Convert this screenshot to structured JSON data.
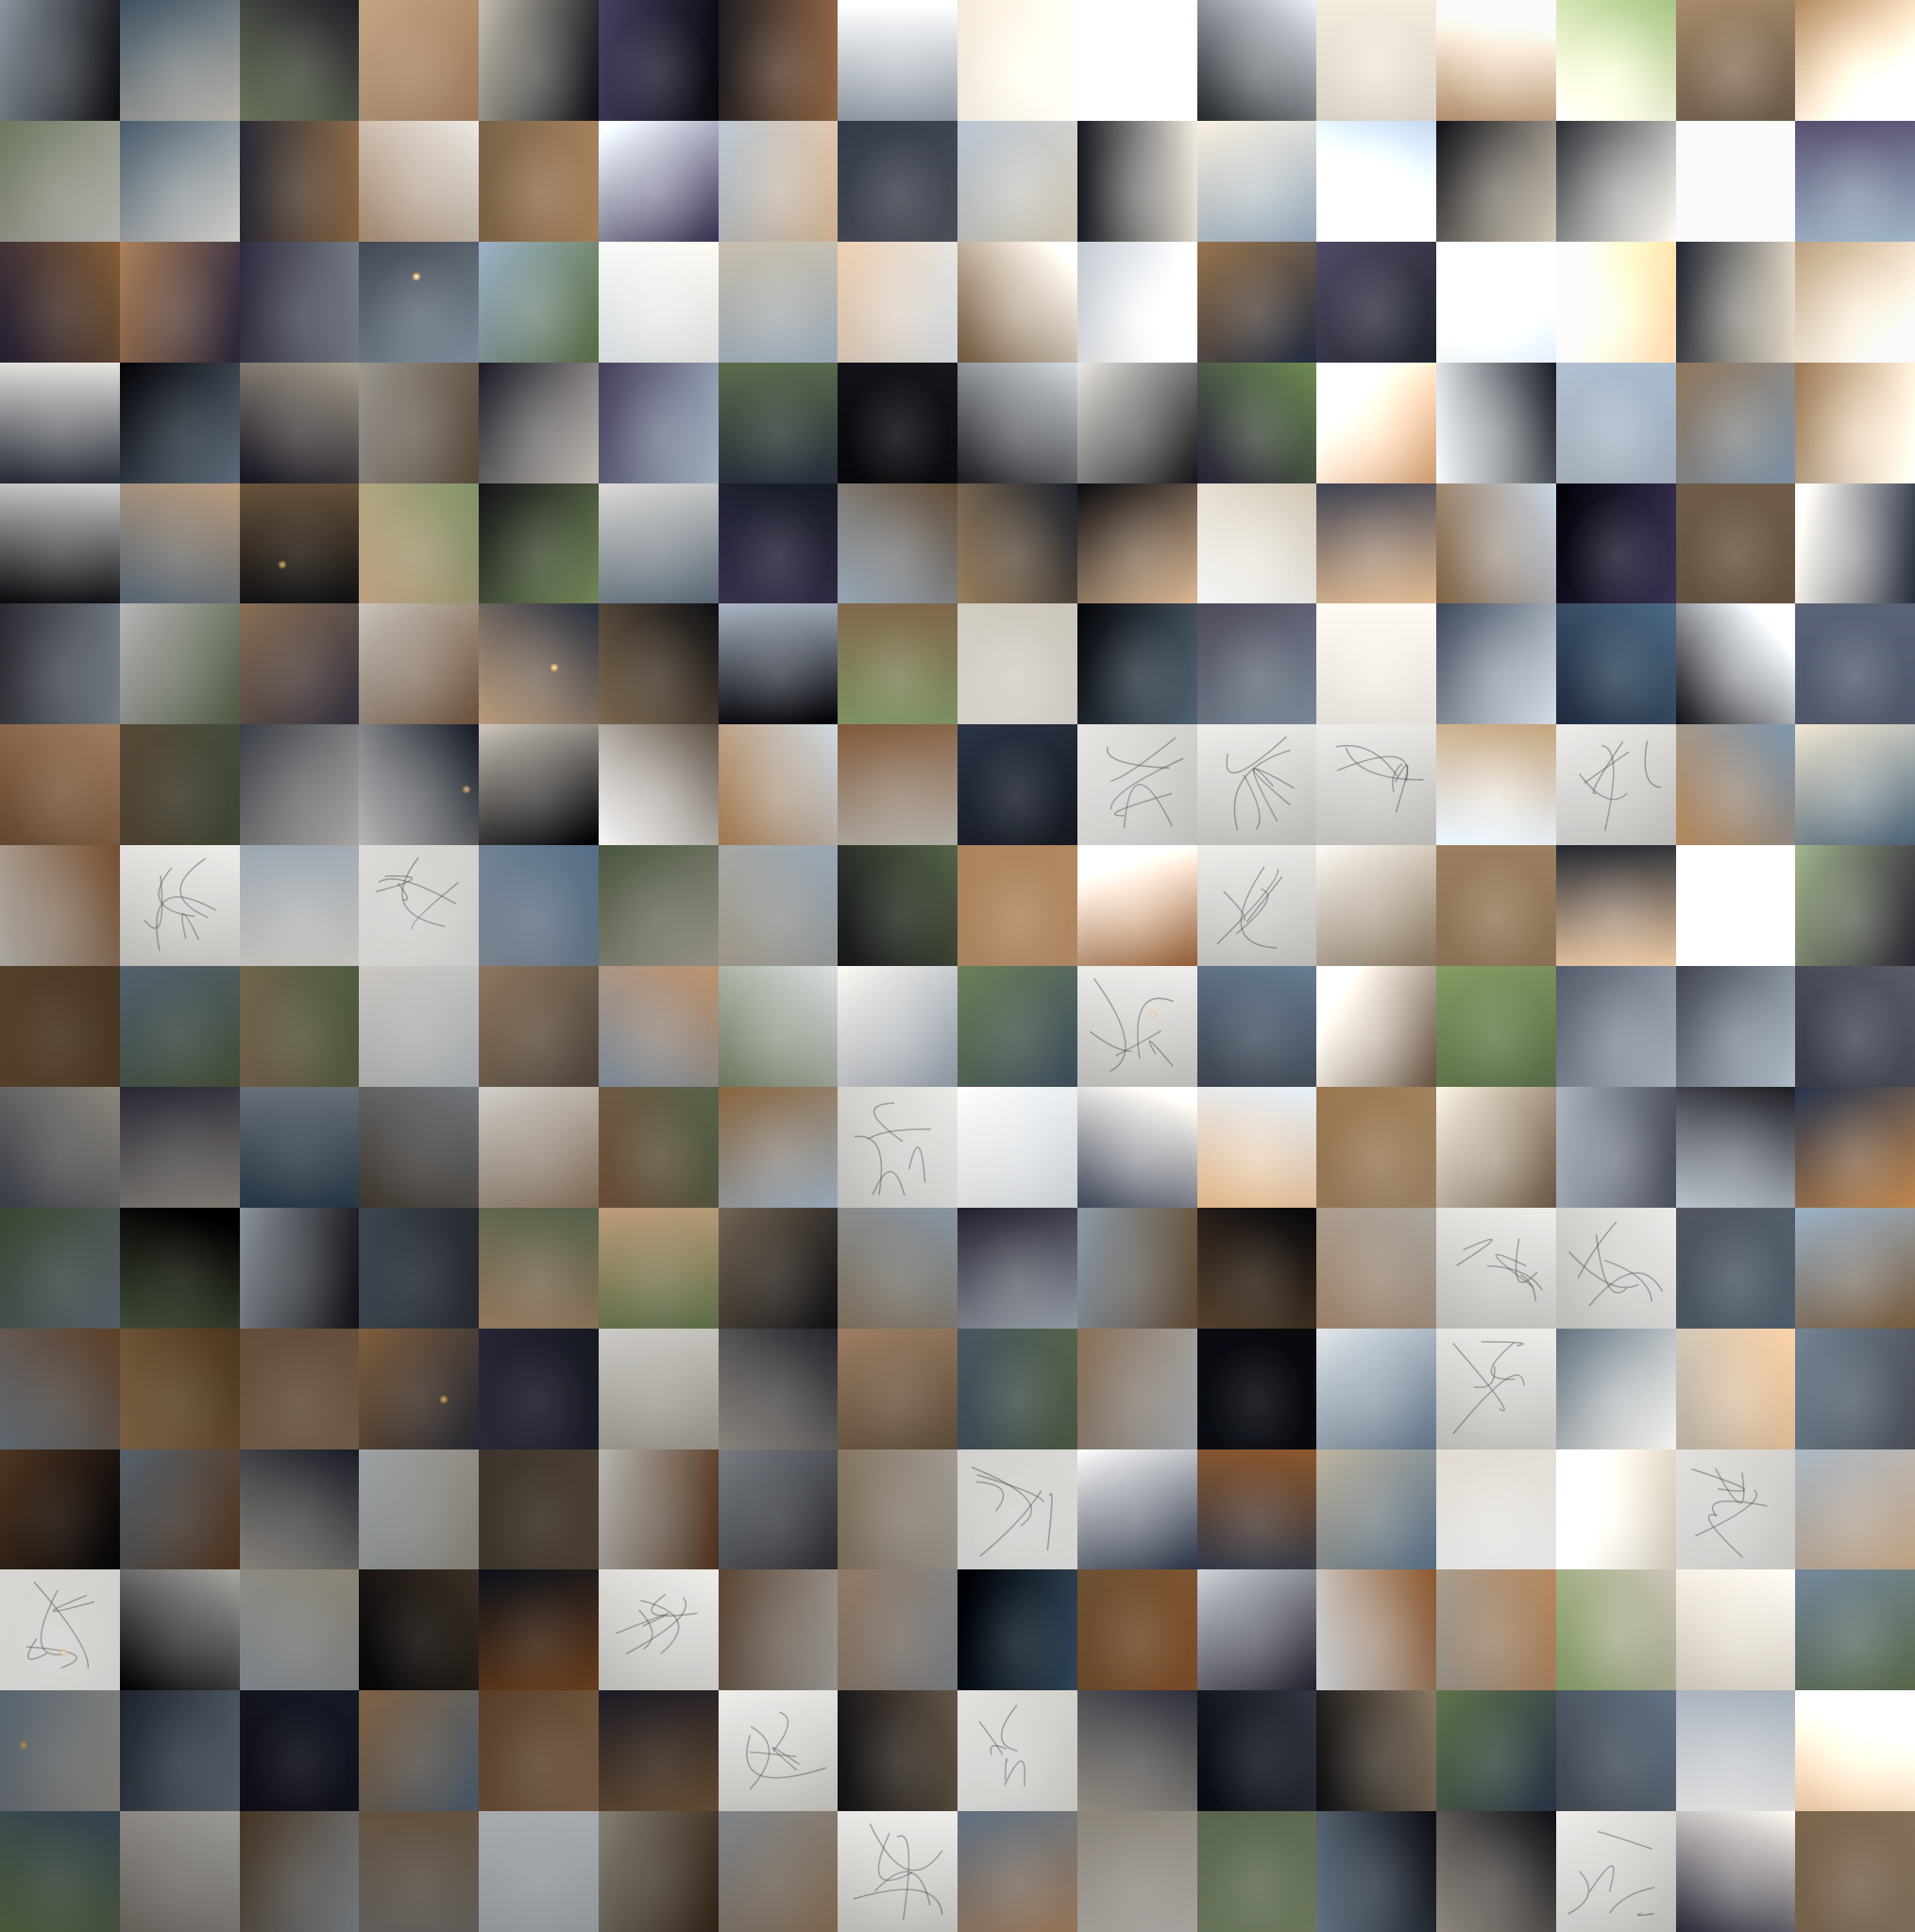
{
  "palette": [
    "#4a4e57",
    "#3a3c46",
    "#2e3440",
    "#1f2228",
    "#5c4f42",
    "#6b5a48",
    "#7a6650",
    "#8a7a66",
    "#9aa0a8",
    "#a9a49c",
    "#b8b2a6",
    "#c9c4bb",
    "#d7d3cc",
    "#e6e3de",
    "#f2f0ec",
    "#2c2a34",
    "#3f3b4c",
    "#1b1b1f",
    "#111114",
    "#5e6a52",
    "#7d8b6a",
    "#4e5e6b",
    "#6c7b8a",
    "#8b97a3",
    "#a6b0ba",
    "#c0c6cc",
    "#dde1e4",
    "#f7f7f7",
    "#9b7e61",
    "#7f5f46",
    "#b08f72",
    "#c9ae92"
  ],
  "grid": {
    "cols": 16,
    "rows": 16
  }
}
